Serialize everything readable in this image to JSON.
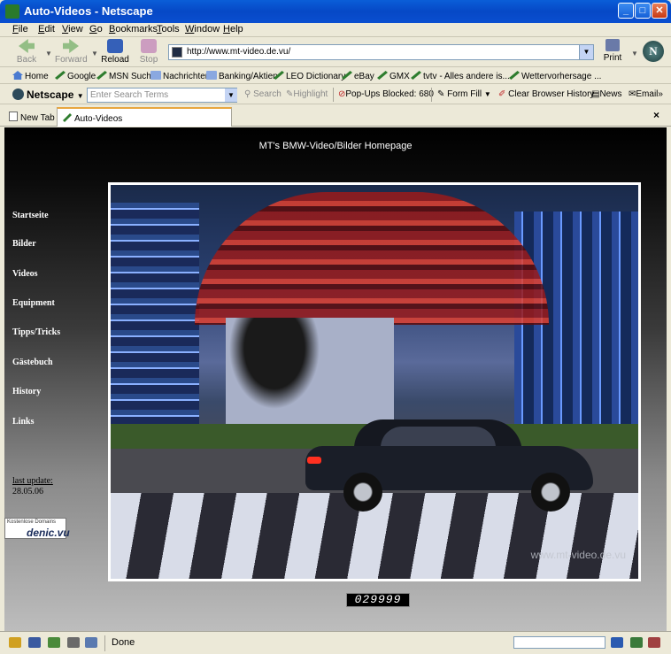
{
  "window": {
    "title": "Auto-Videos - Netscape",
    "minimize": "_",
    "maximize": "□",
    "close": "✕"
  },
  "menu": {
    "items": [
      {
        "key": "F",
        "rest": "ile"
      },
      {
        "key": "E",
        "rest": "dit"
      },
      {
        "key": "V",
        "rest": "iew"
      },
      {
        "key": "G",
        "rest": "o"
      },
      {
        "key": "B",
        "rest": "ookmarks"
      },
      {
        "key": "T",
        "rest": "ools"
      },
      {
        "key": "W",
        "rest": "indow"
      },
      {
        "key": "H",
        "rest": "elp"
      }
    ]
  },
  "nav": {
    "back": "Back",
    "forward": "Forward",
    "reload": "Reload",
    "stop": "Stop",
    "url": "http://www.mt-video.de.vu/",
    "print": "Print",
    "logo": "N"
  },
  "bookmarks": {
    "home": "Home",
    "items": [
      "Google",
      "MSN Suche",
      "Nachrichten",
      "Banking/Aktien",
      "LEO Dictionary",
      "eBay",
      "GMX",
      "tvtv - Alles andere is...",
      "Wettervorhersage ..."
    ]
  },
  "searchbar": {
    "brand": "Netscape",
    "placeholder": "Enter Search Terms",
    "search": "Search",
    "highlight": "Highlight",
    "popups": "Pop-Ups Blocked: 680",
    "formfill": "Form Fill",
    "clear_history": "Clear Browser History",
    "news": "News",
    "email": "Email"
  },
  "tabs": {
    "new_tab": "New Tab",
    "active": "Auto-Videos",
    "close": "×"
  },
  "page": {
    "heading": "MT's BMW-Video/Bilder Homepage",
    "nav": [
      "Startseite",
      "Bilder",
      "Videos",
      "Equipment",
      "Tipps/Tricks",
      "Gästebuch",
      "History",
      "Links"
    ],
    "last_update_label": "last update:",
    "last_update_date": "28.05.06",
    "denic_small": "Kostenlose Domains",
    "denic_logo": "denic.vu",
    "photo_watermark": "www.mt-video.de.vu",
    "counter": "029999"
  },
  "status": {
    "text": "Done"
  }
}
